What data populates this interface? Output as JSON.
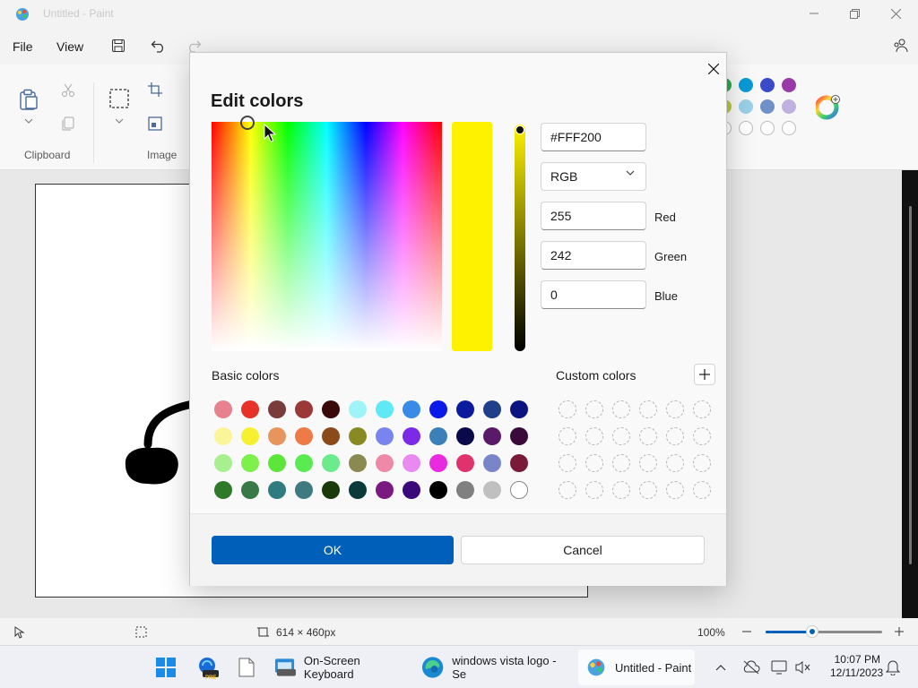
{
  "window": {
    "title": "Untitled - Paint",
    "minimize_icon": "minimize-icon",
    "maximize_icon": "restore-icon",
    "close_icon": "close-icon"
  },
  "menu": {
    "file": "File",
    "view": "View"
  },
  "ribbon": {
    "clipboard_label": "Clipboard",
    "image_label": "Image"
  },
  "status": {
    "size": "614 × 460px",
    "zoom": "100%",
    "zoom_level": 0.4
  },
  "dialog": {
    "title": "Edit colors",
    "hex_value": "#FFF200",
    "mode": "RGB",
    "red_value": "255",
    "red_label": "Red",
    "green_value": "242",
    "green_label": "Green",
    "blue_value": "0",
    "blue_label": "Blue",
    "basic_colors_label": "Basic colors",
    "custom_colors_label": "Custom colors",
    "ok_label": "OK",
    "cancel_label": "Cancel",
    "current_color": "#FFF200",
    "basic_colors": [
      [
        "#e6818d",
        "#e63227",
        "#7a3b3b",
        "#9b3838",
        "#3a0a0a",
        "#9ff4f8",
        "#5ee9f5",
        "#3a8be8",
        "#0b1ae8",
        "#0c1b9e",
        "#1f3f8a",
        "#0b1480"
      ],
      [
        "#fbf59a",
        "#f7f030",
        "#e8955d",
        "#ee7a47",
        "#8a4a1a",
        "#8a8a25",
        "#7a84ef",
        "#7b2ae6",
        "#3b80b8",
        "#0a0a4a",
        "#5a1a6a",
        "#3a0a3a"
      ],
      [
        "#a7ef8f",
        "#7ef04c",
        "#5ce63a",
        "#5aeb52",
        "#6ceb8c",
        "#8a8a50",
        "#ee8aa8",
        "#e88af0",
        "#ea2ae0",
        "#e0336e",
        "#7a84c8",
        "#7a1a3a"
      ],
      [
        "#2e7a2a",
        "#377a48",
        "#2e7b80",
        "#3e7a80",
        "#1a3a0a",
        "#0a3a3a",
        "#7a1a80",
        "#3a0a7a",
        "#000000",
        "#808080",
        "#c0c0c0",
        "#ffffff"
      ]
    ],
    "custom_rows": 4,
    "custom_cols": 6
  },
  "taskbar": {
    "keyboard": "On-Screen Keyboard",
    "edge": "windows vista logo - Se",
    "paint": "Untitled - Paint",
    "time": "10:07 PM",
    "date": "12/11/2023",
    "pre_badge": "PRE"
  }
}
